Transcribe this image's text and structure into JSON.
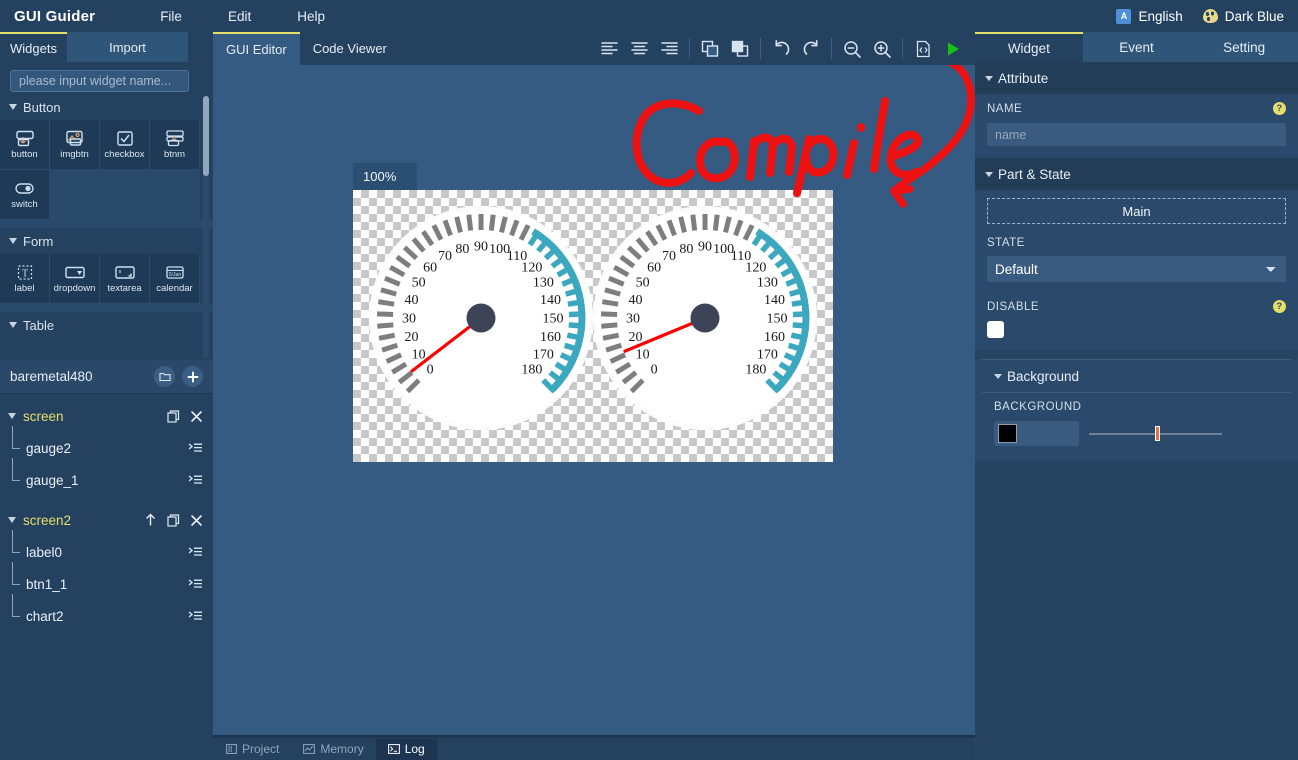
{
  "menubar": {
    "brand": "GUI Guider",
    "items": [
      {
        "label": "File",
        "name": "menu-file"
      },
      {
        "label": "Edit",
        "name": "menu-edit"
      },
      {
        "label": "Help",
        "name": "menu-help"
      }
    ],
    "language": {
      "label": "English",
      "icon": "translate-icon",
      "icon_text": "A"
    },
    "theme": {
      "label": "Dark Blue",
      "icon": "palette-icon"
    }
  },
  "left_panel": {
    "tabs": [
      {
        "label": "Widgets",
        "active": true
      },
      {
        "label": "Import",
        "active": false
      }
    ],
    "search": {
      "placeholder": "please input widget name...",
      "value": ""
    },
    "sections": [
      {
        "title": "Button",
        "widgets": [
          {
            "label": "button",
            "icon": "button-icon"
          },
          {
            "label": "imgbtn",
            "icon": "image-button-icon"
          },
          {
            "label": "checkbox",
            "icon": "checkbox-icon"
          },
          {
            "label": "btnm",
            "icon": "button-matrix-icon"
          },
          {
            "label": "switch",
            "icon": "switch-icon"
          }
        ]
      },
      {
        "title": "Form",
        "widgets": [
          {
            "label": "label",
            "icon": "label-icon"
          },
          {
            "label": "dropdown",
            "icon": "dropdown-icon"
          },
          {
            "label": "textarea",
            "icon": "textarea-icon"
          },
          {
            "label": "calendar",
            "icon": "calendar-icon"
          }
        ]
      },
      {
        "title": "Table",
        "widgets": []
      }
    ]
  },
  "tree_panel": {
    "project_name": "baremetal480",
    "header_actions": [
      {
        "name": "open-folder-button",
        "icon": "folder-icon"
      },
      {
        "name": "add-screen-button",
        "icon": "plus-icon"
      }
    ],
    "screens": [
      {
        "label": "screen",
        "actions": [
          "copy-icon",
          "close-icon"
        ],
        "children": [
          {
            "label": "gauge2",
            "icon": "list-icon"
          },
          {
            "label": "gauge_1",
            "icon": "list-icon"
          }
        ]
      },
      {
        "label": "screen2",
        "actions": [
          "up-arrow-icon",
          "copy-icon",
          "close-icon"
        ],
        "children": [
          {
            "label": "label0",
            "icon": "list-icon"
          },
          {
            "label": "btn1_1",
            "icon": "list-icon"
          },
          {
            "label": "chart2",
            "icon": "list-icon"
          }
        ]
      }
    ]
  },
  "editor": {
    "tabs": [
      {
        "label": "GUI Editor",
        "active": true
      },
      {
        "label": "Code Viewer",
        "active": false
      }
    ],
    "toolbar": [
      {
        "name": "align-left-button",
        "icon": "align-left-icon"
      },
      {
        "name": "align-center-button",
        "icon": "align-center-icon"
      },
      {
        "name": "align-right-button",
        "icon": "align-right-icon"
      },
      {
        "name": "bring-forward-button",
        "icon": "bring-forward-icon"
      },
      {
        "name": "send-backward-button",
        "icon": "send-backward-icon"
      },
      {
        "name": "undo-button",
        "icon": "undo-icon"
      },
      {
        "name": "redo-button",
        "icon": "redo-icon"
      },
      {
        "name": "zoom-out-button",
        "icon": "zoom-out-icon"
      },
      {
        "name": "zoom-in-button",
        "icon": "zoom-in-icon"
      },
      {
        "name": "generate-code-button",
        "icon": "code-file-icon"
      },
      {
        "name": "compile-run-button",
        "icon": "play-icon"
      }
    ],
    "zoom_level": "100%",
    "annotation": {
      "text": "Compile",
      "color": "#EE1111"
    },
    "accent_play_color": "#17C017"
  },
  "canvas": {
    "gauges": [
      {
        "name": "gauge2",
        "needle_value": 5,
        "scale_min": 0,
        "scale_max": 180,
        "labels": [
          "0",
          "10",
          "20",
          "30",
          "40",
          "50",
          "60",
          "70",
          "80",
          "90",
          "100",
          "110",
          "120",
          "130",
          "140",
          "150",
          "160",
          "170",
          "180"
        ],
        "arc_color": "#3BA8C0",
        "needle_color": "#FF0000",
        "hub_color": "#3D4458",
        "face_color": "#FFFFFF"
      },
      {
        "name": "gauge_1",
        "needle_value": 15,
        "scale_min": 0,
        "scale_max": 180,
        "labels": [
          "0",
          "10",
          "20",
          "30",
          "40",
          "50",
          "60",
          "70",
          "80",
          "90",
          "100",
          "110",
          "120",
          "130",
          "140",
          "150",
          "160",
          "170",
          "180"
        ],
        "arc_color": "#3BA8C0",
        "needle_color": "#FF0000",
        "hub_color": "#3D4458",
        "face_color": "#FFFFFF"
      }
    ]
  },
  "right_panel": {
    "tabs": [
      {
        "label": "Widget",
        "active": true
      },
      {
        "label": "Event",
        "active": false
      },
      {
        "label": "Setting",
        "active": false
      }
    ],
    "sections": {
      "attribute": {
        "title": "Attribute",
        "name_label": "NAME",
        "name_placeholder": "name",
        "name_value": "",
        "help": "?"
      },
      "part_state": {
        "title": "Part & State",
        "part_button": "Main",
        "state_label": "STATE",
        "state_value": "Default",
        "state_options": [
          "Default"
        ],
        "disable_label": "DISABLE",
        "disable_checked": false,
        "help": "?"
      },
      "background": {
        "title": "Background",
        "label": "BACKGROUND",
        "color_value": "#000000",
        "opacity_percent": 50
      }
    }
  },
  "bottom_bar": {
    "tabs": [
      {
        "label": "Project",
        "icon": "project-icon",
        "active": false
      },
      {
        "label": "Memory",
        "icon": "memory-chart-icon",
        "active": false
      },
      {
        "label": "Log",
        "icon": "terminal-icon",
        "active": true
      }
    ]
  }
}
